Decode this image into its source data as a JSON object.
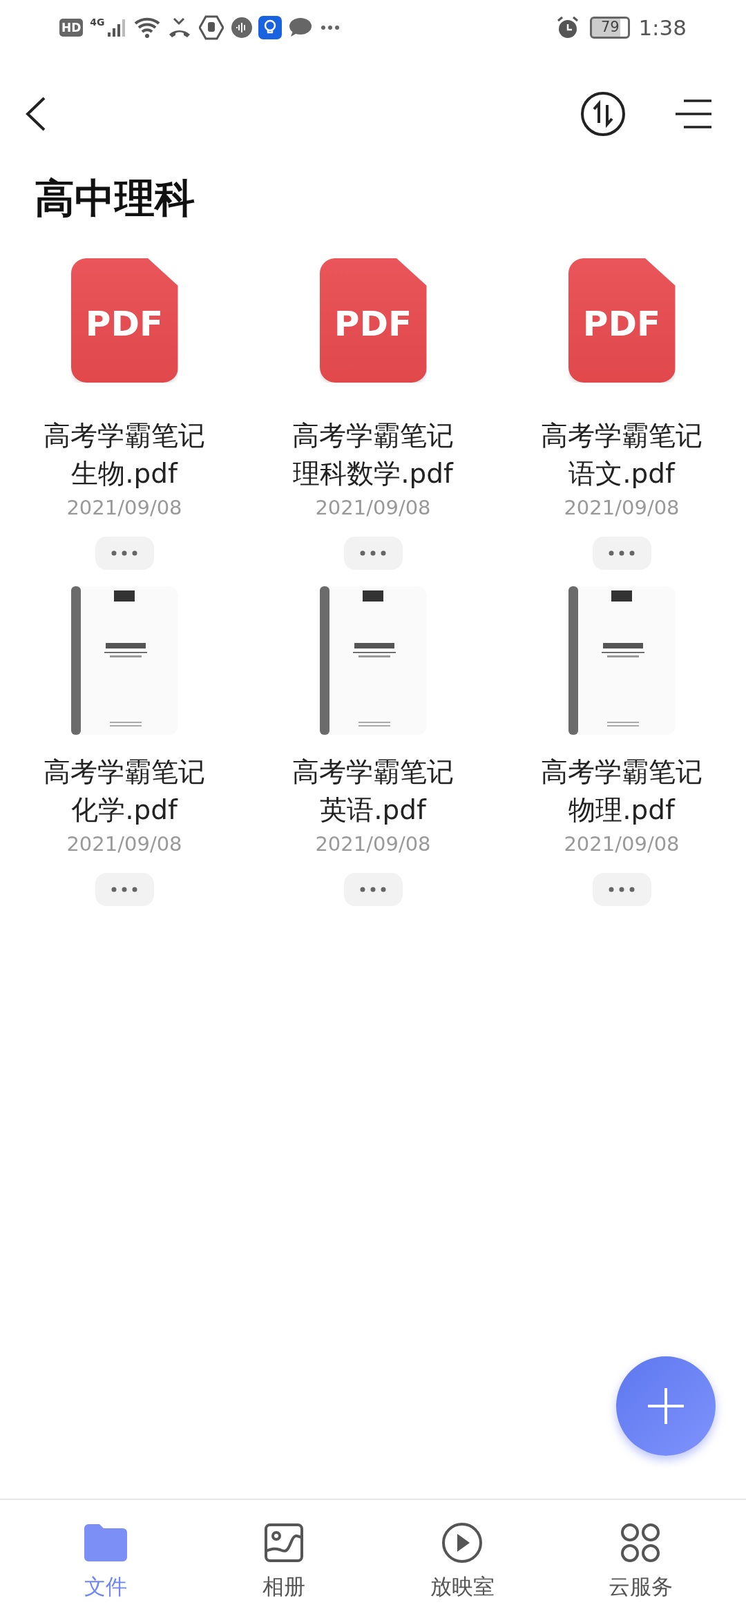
{
  "status_bar": {
    "badge": "HD",
    "network": "4G",
    "battery": "79",
    "time": "1:38"
  },
  "title": "高中理科",
  "files": [
    {
      "kind": "pdf",
      "icon_text": "PDF",
      "name_lines": [
        "高考学霸笔记",
        "生物.pdf"
      ],
      "date": "2021/09/08"
    },
    {
      "kind": "pdf",
      "icon_text": "PDF",
      "name_lines": [
        "高考学霸笔记",
        "理科数学.pdf"
      ],
      "date": "2021/09/08"
    },
    {
      "kind": "pdf",
      "icon_text": "PDF",
      "name_lines": [
        "高考学霸笔记",
        "语文.pdf"
      ],
      "date": "2021/09/08"
    },
    {
      "kind": "picture",
      "name_lines": [
        "高考学霸笔记",
        "化学.pdf"
      ],
      "date": "2021/09/08"
    },
    {
      "kind": "picture",
      "name_lines": [
        "高考学霸笔记",
        "英语.pdf"
      ],
      "date": "2021/09/08"
    },
    {
      "kind": "picture",
      "name_lines": [
        "高考学霸笔记",
        "物理.pdf"
      ],
      "date": "2021/09/08"
    }
  ],
  "nav": [
    {
      "kind": "files",
      "label": "文件",
      "selected": true
    },
    {
      "kind": "album",
      "label": "相册",
      "selected": false
    },
    {
      "kind": "player",
      "label": "放映室",
      "selected": false
    },
    {
      "kind": "cloud",
      "label": "云服务",
      "selected": false
    }
  ]
}
